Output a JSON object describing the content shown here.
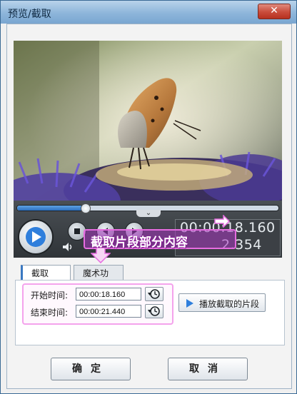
{
  "window": {
    "title": "预览/截取",
    "close_label": "✕"
  },
  "player": {
    "progress": 0.26,
    "current_time": "00:00:18.160",
    "total_time_visible": "2.354",
    "total_time_prefix_visible": "00:0"
  },
  "callout": {
    "text": "截取片段部分内容"
  },
  "tabs": [
    {
      "label": "截取",
      "active": true
    },
    {
      "label": "魔术功能",
      "active": false
    }
  ],
  "clip": {
    "start_label": "开始时间:",
    "start_value": "00:00:18.160",
    "end_label": "结束时间:",
    "end_value": "00:00:21.440",
    "play_clip_label": "播放截取的片段"
  },
  "footer": {
    "ok_label": "确定",
    "cancel_label": "取消"
  },
  "colors": {
    "accent": "#2c6fc0",
    "highlight": "#e66ce0"
  }
}
